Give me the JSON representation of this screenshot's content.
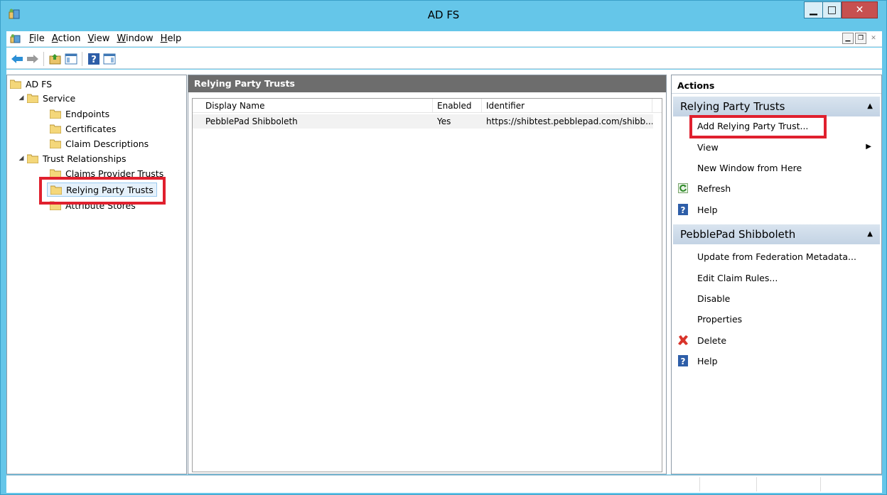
{
  "window": {
    "title": "AD FS"
  },
  "menu": {
    "items": [
      {
        "id": "file",
        "underline": "F",
        "rest": "ile"
      },
      {
        "id": "action",
        "underline": "A",
        "rest": "ction"
      },
      {
        "id": "view",
        "underline": "V",
        "rest": "iew"
      },
      {
        "id": "window",
        "underline": "W",
        "rest": "indow"
      },
      {
        "id": "help",
        "underline": "H",
        "rest": "elp"
      }
    ]
  },
  "tree": {
    "root": "AD FS",
    "service": "Service",
    "endpoints": "Endpoints",
    "certificates": "Certificates",
    "claim_descriptions": "Claim Descriptions",
    "trust_relationships": "Trust Relationships",
    "claims_provider_trusts": "Claims Provider Trusts",
    "relying_party_trusts": "Relying Party Trusts",
    "attribute_stores": "Attribute Stores"
  },
  "middle": {
    "header": "Relying Party Trusts",
    "columns": [
      "Display Name",
      "Enabled",
      "Identifier"
    ],
    "rows": [
      {
        "display_name": "PebblePad Shibboleth",
        "enabled": "Yes",
        "identifier": "https://shibtest.pebblepad.com/shibb..."
      }
    ]
  },
  "actions": {
    "title": "Actions",
    "group1": {
      "title": "Relying Party Trusts",
      "items": {
        "add": "Add Relying Party Trust...",
        "view": "View",
        "new_window": "New Window from Here",
        "refresh": "Refresh",
        "help": "Help"
      }
    },
    "group2": {
      "title": "PebblePad Shibboleth",
      "items": {
        "update": "Update from Federation Metadata...",
        "edit_claims": "Edit Claim Rules...",
        "disable": "Disable",
        "properties": "Properties",
        "delete": "Delete",
        "help": "Help"
      }
    }
  },
  "colors": {
    "titlebar": "#65c6e9",
    "highlight": "#e0202e",
    "group_header": "#c3d3e4"
  }
}
